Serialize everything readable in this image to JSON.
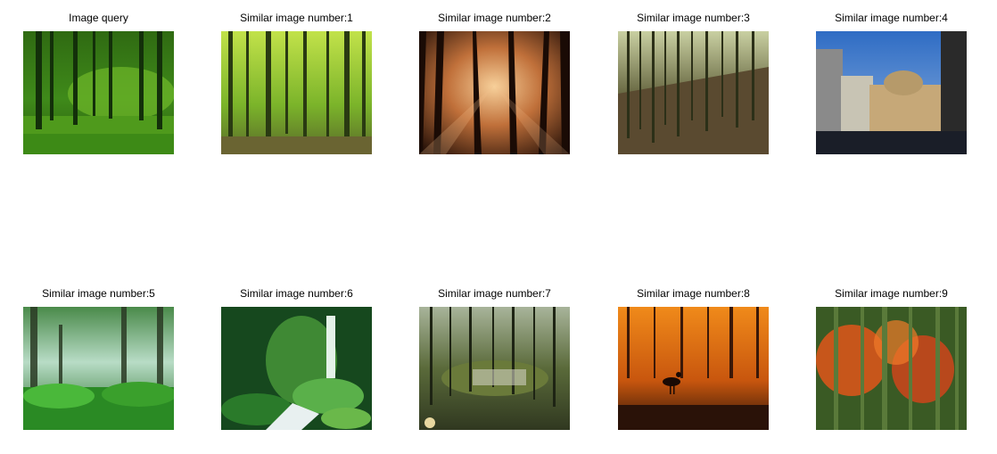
{
  "captions": [
    "Image query",
    "Similar image number:1",
    "Similar image number:2",
    "Similar image number:3",
    "Similar image number:4",
    "Similar image number:5",
    "Similar image number:6",
    "Similar image number:7",
    "Similar image number:8",
    "Similar image number:9"
  ],
  "thumbnails": [
    {
      "subject": "green-forest-meadow",
      "colors": [
        "#1b4a0e",
        "#5a9a1e",
        "#2f6e10"
      ]
    },
    {
      "subject": "bright-spring-forest",
      "colors": [
        "#a8d43a",
        "#4d7f16",
        "#6c5a2e"
      ]
    },
    {
      "subject": "sunbeams-through-trees",
      "colors": [
        "#e8a15a",
        "#5a2f16",
        "#1a0d08"
      ]
    },
    {
      "subject": "bamboo-forest-slope",
      "colors": [
        "#c7c39a",
        "#4a4630",
        "#2a2a1a"
      ]
    },
    {
      "subject": "domed-building-street",
      "colors": [
        "#3a78c8",
        "#c8b08a",
        "#1b2030"
      ]
    },
    {
      "subject": "misty-fern-forest",
      "colors": [
        "#bfe0d0",
        "#2a7a3a",
        "#0e3a14"
      ]
    },
    {
      "subject": "forest-waterfall",
      "colors": [
        "#1d5a2a",
        "#6ab04a",
        "#e8f0e8"
      ]
    },
    {
      "subject": "surreal-forest-clearing",
      "colors": [
        "#9aa88a",
        "#4a5a2a",
        "#2a3018"
      ]
    },
    {
      "subject": "bird-silhouette-orange-water",
      "colors": [
        "#f08a1a",
        "#6a2a0a",
        "#1a0d08"
      ]
    },
    {
      "subject": "autumn-bamboo-grove",
      "colors": [
        "#e05a1a",
        "#4a7a2a",
        "#2a3a1a"
      ]
    }
  ]
}
